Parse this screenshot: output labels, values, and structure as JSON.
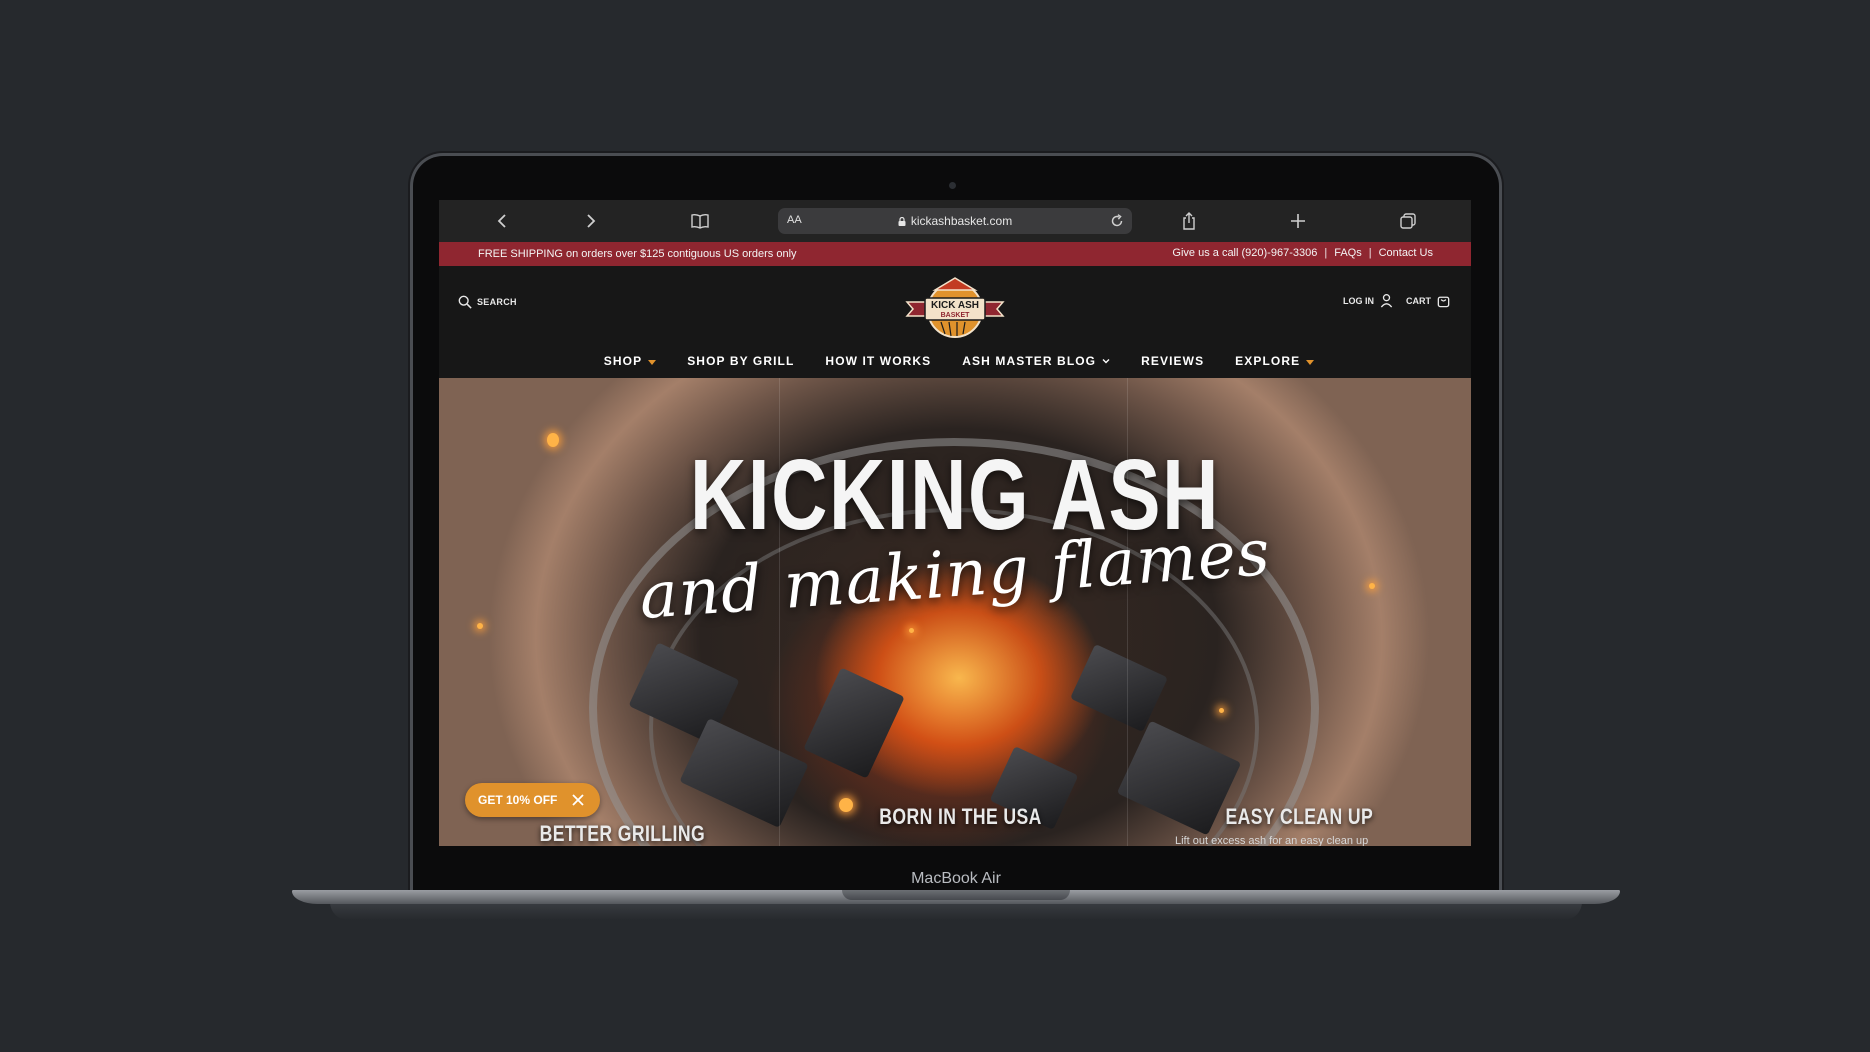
{
  "device": {
    "model_label": "MacBook Air"
  },
  "browser": {
    "url_aa": "AA",
    "url": "kickashbasket.com",
    "icons": [
      "back-icon",
      "forward-icon",
      "bookmarks-icon",
      "lock-icon",
      "reload-icon",
      "share-icon",
      "new-tab-icon",
      "tabs-icon"
    ]
  },
  "promo_bar": {
    "shipping_text": "FREE SHIPPING on orders over $125 contiguous US orders only",
    "phone_text": "Give us a call (920)-967-3306",
    "faqs": "FAQs",
    "contact": "Contact Us",
    "separator": "|",
    "background": "#8f2630"
  },
  "header": {
    "search_label": "SEARCH",
    "login_label": "LOG IN",
    "cart_label": "CART",
    "logo": {
      "line1": "KICK ASH",
      "line2": "BASKET"
    }
  },
  "nav": {
    "items": [
      {
        "label": "SHOP"
      },
      {
        "label": "SHOP BY GRILL"
      },
      {
        "label": "HOW IT WORKS"
      },
      {
        "label": "ASH MASTER BLOG"
      },
      {
        "label": "REVIEWS"
      },
      {
        "label": "EXPLORE"
      }
    ],
    "accent": "#e0922c"
  },
  "hero": {
    "title": "KICKING ASH",
    "subtitle": "and making flames",
    "features": [
      {
        "title": "BETTER GRILLING"
      },
      {
        "title": "BORN IN THE USA"
      },
      {
        "title": "EASY CLEAN UP",
        "subtitle": "Lift out excess ash for an easy clean up"
      }
    ],
    "discount_button": "GET 10% OFF"
  }
}
